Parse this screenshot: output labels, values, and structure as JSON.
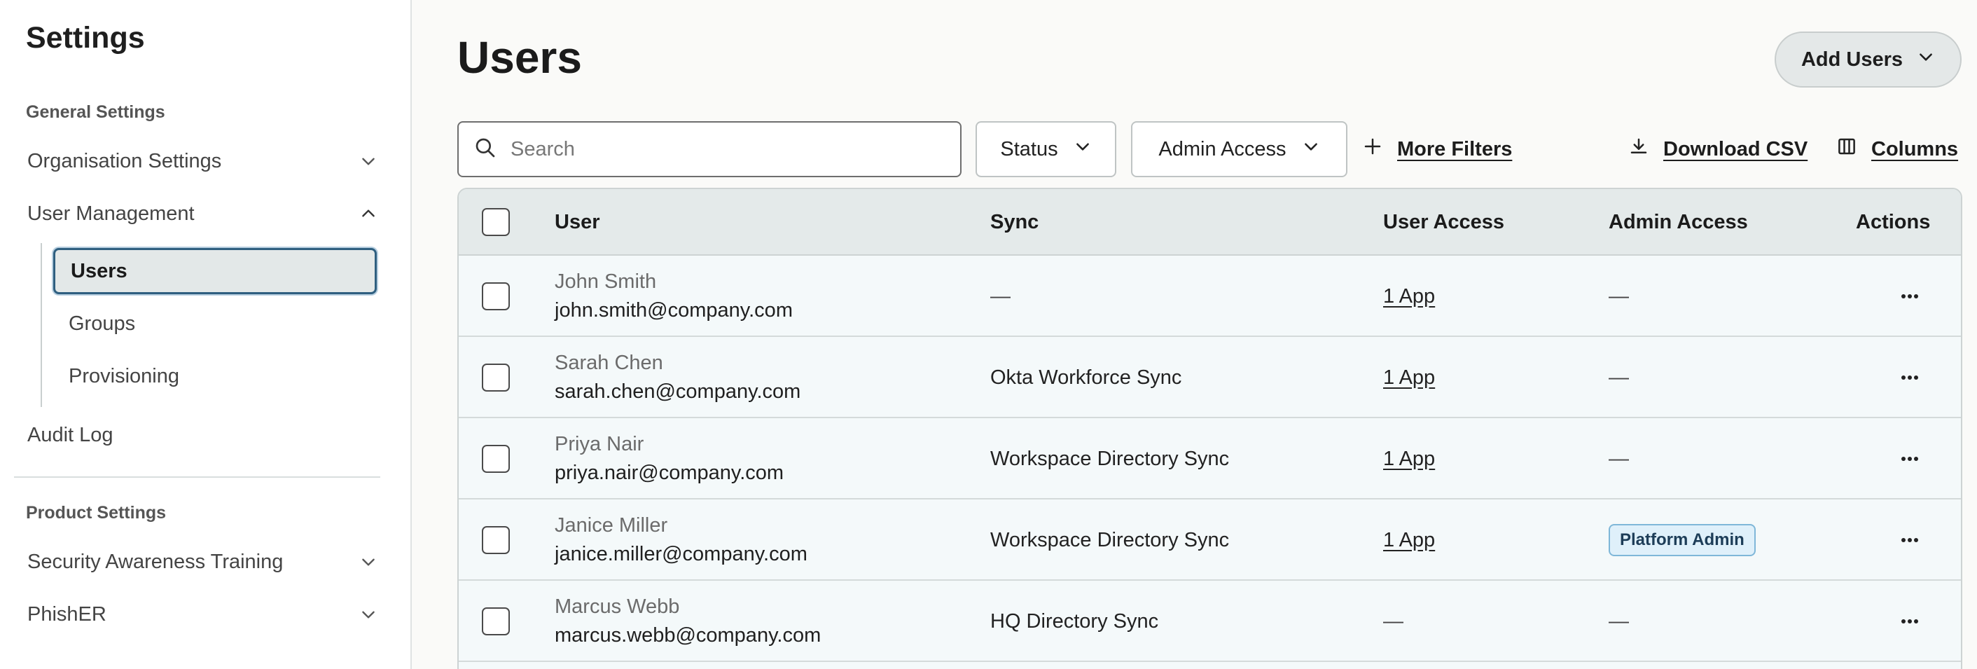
{
  "sidebar": {
    "title": "Settings",
    "general_section": "General Settings",
    "product_section": "Product Settings",
    "items": [
      {
        "label": "Organisation Settings",
        "icon": "chevron-down-icon"
      },
      {
        "label": "User Management",
        "icon": "chevron-up-icon"
      },
      {
        "label": "Audit Log"
      },
      {
        "label": "Security Awareness Training",
        "icon": "chevron-down-icon"
      },
      {
        "label": "PhishER",
        "icon": "chevron-down-icon"
      }
    ],
    "sub_items": [
      {
        "label": "Users",
        "active": true
      },
      {
        "label": "Groups",
        "active": false
      },
      {
        "label": "Provisioning",
        "active": false
      }
    ]
  },
  "header": {
    "title": "Users",
    "add_users_label": "Add Users",
    "add_users_icon": "chevron-down-icon"
  },
  "toolbar": {
    "search_placeholder": "Search",
    "search_value": "",
    "status_label": "Status",
    "admin_access_label": "Admin Access",
    "more_filters_label": "More Filters",
    "download_csv_label": "Download CSV",
    "columns_label": "Columns"
  },
  "table": {
    "headers": {
      "user": "User",
      "sync": "Sync",
      "user_access": "User Access",
      "admin_access": "Admin Access",
      "actions": "Actions"
    },
    "rows": [
      {
        "name": "John Smith",
        "email": "john.smith@company.com",
        "sync": "—",
        "user_access": "1 App",
        "admin_access": "—"
      },
      {
        "name": "Sarah Chen",
        "email": "sarah.chen@company.com",
        "sync": "Okta Workforce Sync",
        "user_access": "1 App",
        "admin_access": "—"
      },
      {
        "name": "Priya Nair",
        "email": "priya.nair@company.com",
        "sync": "Workspace Directory Sync",
        "user_access": "1 App",
        "admin_access": "—"
      },
      {
        "name": "Janice Miller",
        "email": "janice.miller@company.com",
        "sync": "Workspace Directory Sync",
        "user_access": "1 App",
        "admin_access": "Platform Admin"
      },
      {
        "name": "Marcus Webb",
        "email": "marcus.webb@company.com",
        "sync": "HQ Directory Sync",
        "user_access": "—",
        "admin_access": "—"
      }
    ]
  },
  "colors": {
    "accent_border": "#2f5f80",
    "badge_bg": "#dff0fa",
    "badge_border": "#7fb7d8",
    "header_bg": "#e4eaea",
    "row_bg": "#f4f9fa"
  }
}
